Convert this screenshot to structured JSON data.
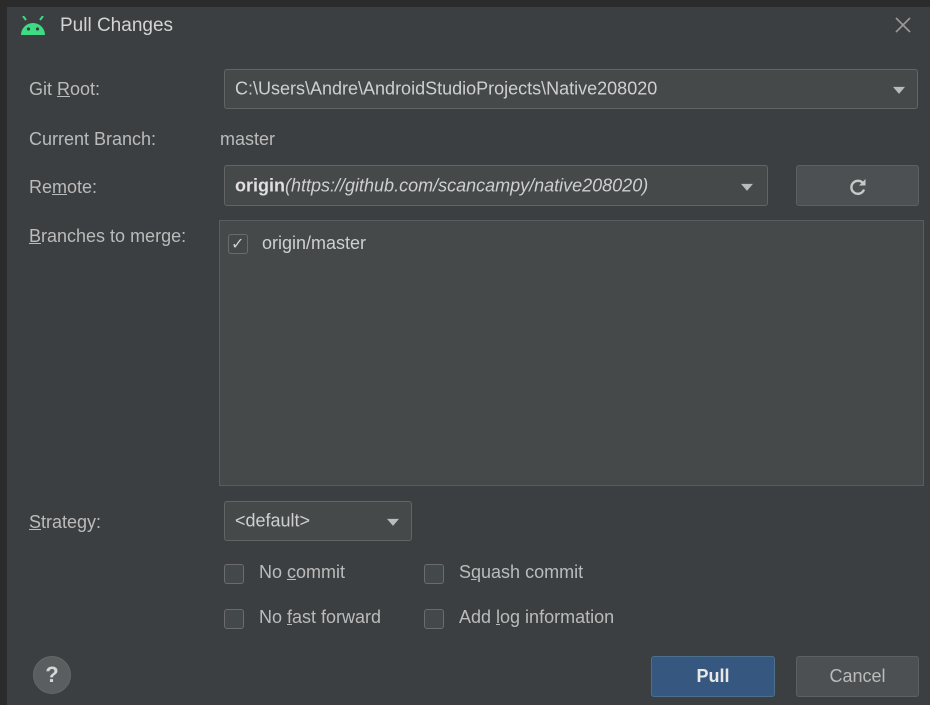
{
  "window": {
    "title": "Pull Changes",
    "icon": "android-icon",
    "accent": "#3ddc84"
  },
  "form": {
    "git_root": {
      "label_pre": "Git ",
      "label_mn": "R",
      "label_post": "oot:",
      "value": "C:\\Users\\Andre\\AndroidStudioProjects\\Native208020"
    },
    "current_branch": {
      "label": "Current Branch:",
      "value": "master"
    },
    "remote": {
      "label_pre": "Re",
      "label_mn": "m",
      "label_post": "ote:",
      "name": "origin",
      "url": "(https://github.com/scancampy/native208020)"
    },
    "branches": {
      "label_mn": "B",
      "label_post": "ranches to merge:",
      "items": [
        {
          "name": "origin/master",
          "checked": true
        }
      ]
    },
    "strategy": {
      "label_mn": "S",
      "label_post": "trategy:",
      "value": "<default>"
    },
    "options": {
      "no_commit": {
        "pre": "No ",
        "mn": "c",
        "post": "ommit",
        "checked": false
      },
      "squash_commit": {
        "pre": "S",
        "mn": "q",
        "post": "uash commit",
        "checked": false
      },
      "no_fast_forward": {
        "pre": "No ",
        "mn": "f",
        "post": "ast forward",
        "checked": false
      },
      "add_log": {
        "pre": "Add ",
        "mn": "l",
        "post": "og information",
        "checked": false
      }
    }
  },
  "buttons": {
    "help": "?",
    "pull": "Pull",
    "cancel": "Cancel"
  },
  "colors": {
    "background": "#3c3f41",
    "field": "#45494a",
    "primary_button": "#365880"
  }
}
